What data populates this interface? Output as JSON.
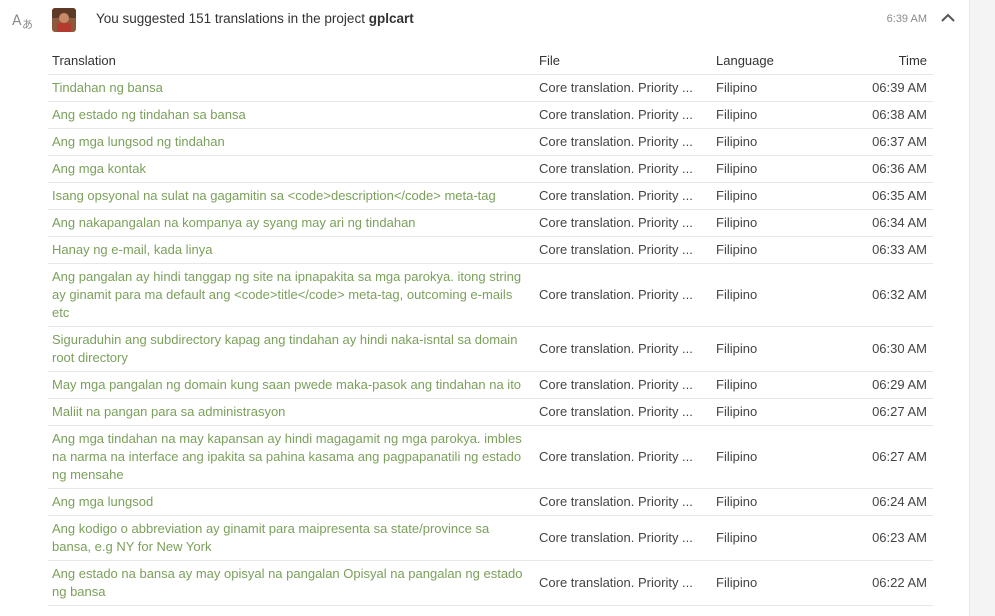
{
  "header": {
    "text_prefix": "You suggested 151 translations in the project",
    "project_name": "gplcart",
    "time": "6:39 AM"
  },
  "table": {
    "columns": {
      "translation": "Translation",
      "file": "File",
      "language": "Language",
      "time": "Time"
    },
    "rows": [
      {
        "translation": "Tindahan ng bansa",
        "file": "Core translation. Priority ...",
        "language": "Filipino",
        "time": "06:39 AM"
      },
      {
        "translation": "Ang estado ng tindahan sa bansa",
        "file": "Core translation. Priority ...",
        "language": "Filipino",
        "time": "06:38 AM"
      },
      {
        "translation": "Ang mga lungsod ng tindahan",
        "file": "Core translation. Priority ...",
        "language": "Filipino",
        "time": "06:37 AM"
      },
      {
        "translation": "Ang mga kontak",
        "file": "Core translation. Priority ...",
        "language": "Filipino",
        "time": "06:36 AM"
      },
      {
        "translation": "Isang opsyonal na sulat na gagamitin sa <code>description</code> meta-tag",
        "file": "Core translation. Priority ...",
        "language": "Filipino",
        "time": "06:35 AM"
      },
      {
        "translation": "Ang nakapangalan na kompanya ay syang may ari ng tindahan",
        "file": "Core translation. Priority ...",
        "language": "Filipino",
        "time": "06:34 AM"
      },
      {
        "translation": "Hanay ng e-mail, kada linya",
        "file": "Core translation. Priority ...",
        "language": "Filipino",
        "time": "06:33 AM"
      },
      {
        "translation": "Ang pangalan ay hindi tanggap ng site na ipnapakita sa mga parokya. itong string ay ginamit para ma default ang <code>title</code> meta-tag, outcoming e-mails etc",
        "file": "Core translation. Priority ...",
        "language": "Filipino",
        "time": "06:32 AM"
      },
      {
        "translation": "Siguraduhin ang subdirectory kapag ang tindahan ay hindi naka-isntal sa domain root directory",
        "file": "Core translation. Priority ...",
        "language": "Filipino",
        "time": "06:30 AM"
      },
      {
        "translation": "May mga pangalan ng domain kung saan pwede maka-pasok ang tindahan na ito",
        "file": "Core translation. Priority ...",
        "language": "Filipino",
        "time": "06:29 AM"
      },
      {
        "translation": "Maliit na pangan para sa administrasyon",
        "file": "Core translation. Priority ...",
        "language": "Filipino",
        "time": "06:27 AM"
      },
      {
        "translation": "Ang mga tindahan na may kapansan ay hindi magagamit ng mga parokya. imbles na narma na interface ang ipakita sa pahina kasama ang pagpapanatili ng estado ng mensahe",
        "file": "Core translation. Priority ...",
        "language": "Filipino",
        "time": "06:27 AM"
      },
      {
        "translation": "Ang mga lungsod",
        "file": "Core translation. Priority ...",
        "language": "Filipino",
        "time": "06:24 AM"
      },
      {
        "translation": "Ang kodigo o abbreviation ay ginamit para maipresenta sa state/province sa bansa, e.g NY for New York",
        "file": "Core translation. Priority ...",
        "language": "Filipino",
        "time": "06:23 AM"
      },
      {
        "translation": "Ang estado na bansa ay may opisyal na pangalan Opisyal na pangalan ng estado ng bansa",
        "file": "Core translation. Priority ...",
        "language": "Filipino",
        "time": "06:22 AM"
      }
    ]
  },
  "colors": {
    "link_green": "#7ba05b",
    "text": "#333333",
    "muted": "#8a8a8a",
    "divider": "#e8e8e8"
  },
  "icons": {
    "activity": "translate-icon",
    "avatar": "user-avatar",
    "toggle": "chevron-up-icon"
  }
}
